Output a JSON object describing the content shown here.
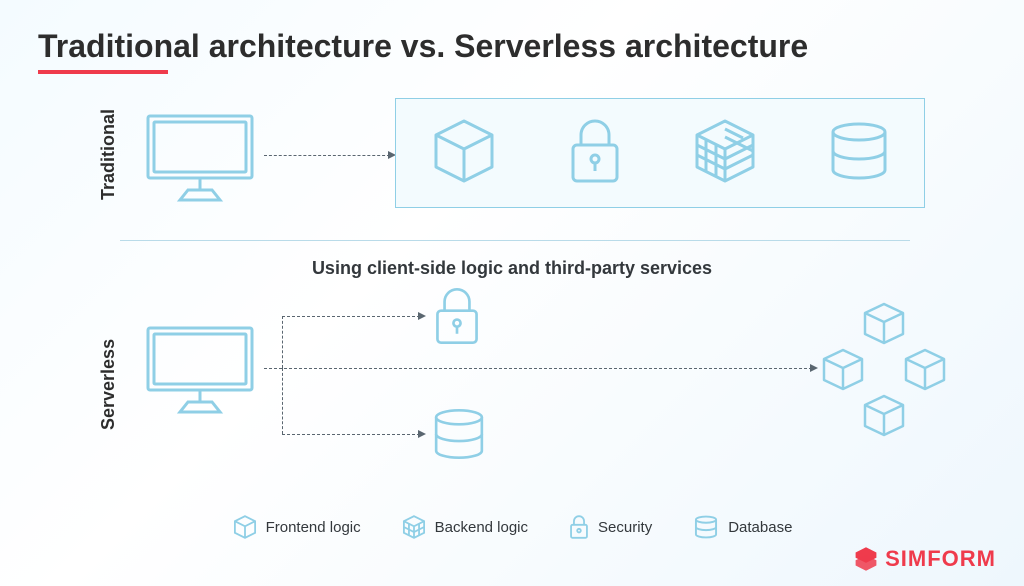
{
  "title": "Traditional architecture vs. Serverless architecture",
  "labels": {
    "traditional": "Traditional",
    "serverless": "Serverless"
  },
  "subtitle": "Using client-side logic and third-party services",
  "legend": {
    "frontend": "Frontend logic",
    "backend": "Backend logic",
    "security": "Security",
    "database": "Database"
  },
  "icons": {
    "cube": "cube-icon",
    "lock": "lock-icon",
    "grid_cube": "grid-cube-icon",
    "database": "database-icon",
    "monitor": "monitor-icon",
    "cube_cluster": "cube-cluster-icon"
  },
  "colors": {
    "line": "#8fcfe6",
    "accent": "#ef3b4c",
    "text": "#2d2d2d"
  },
  "brand": "SIMFORM"
}
